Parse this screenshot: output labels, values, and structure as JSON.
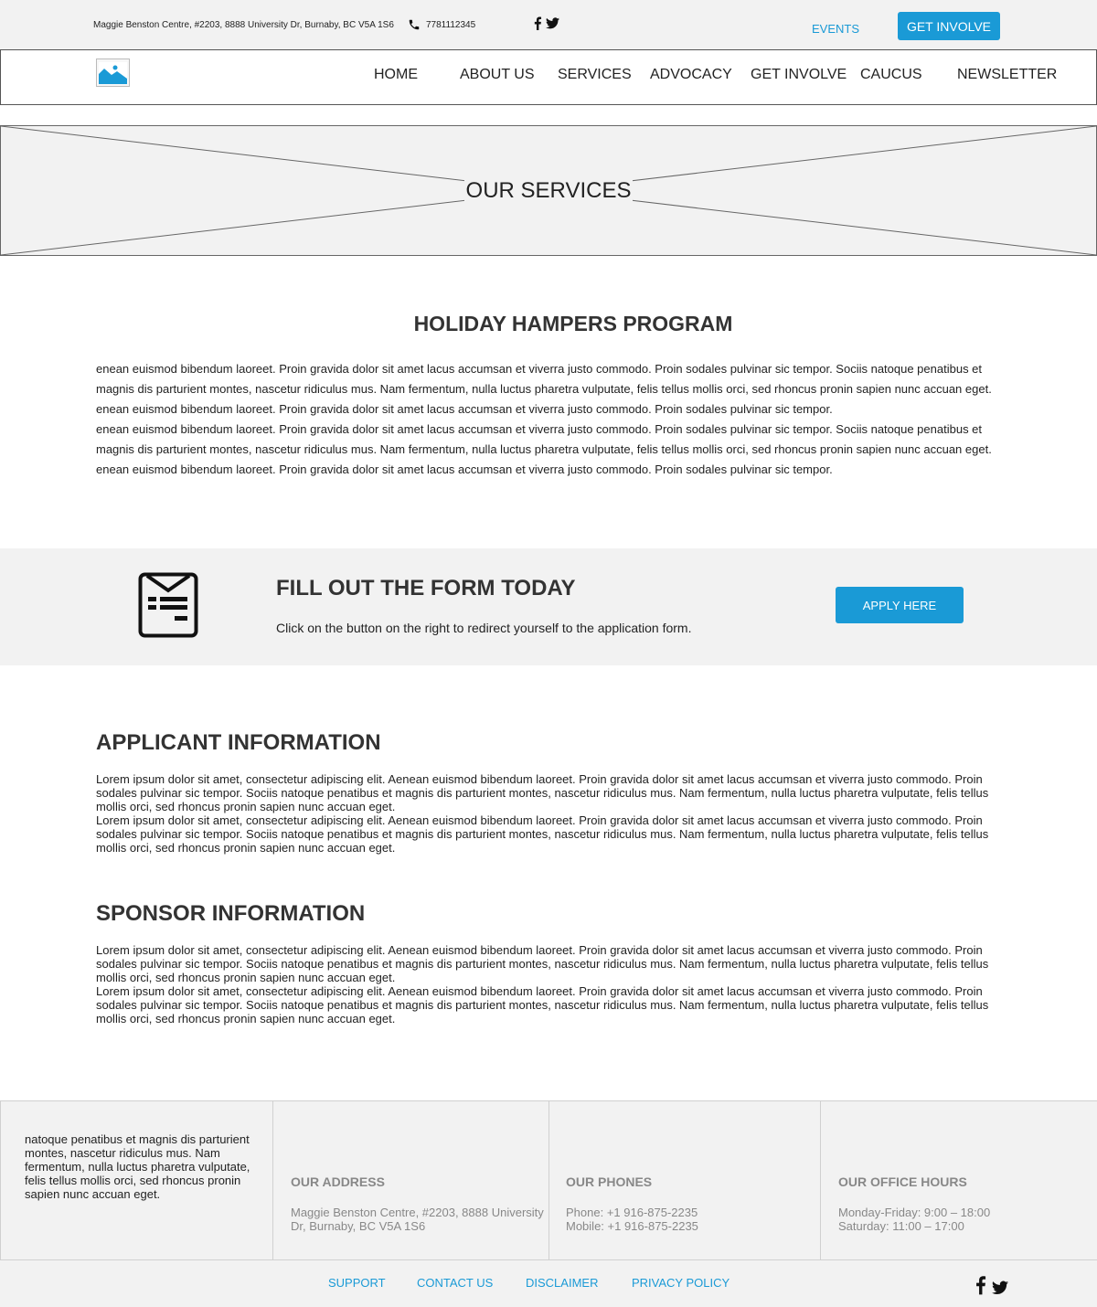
{
  "topbar": {
    "address": "Maggie Benston Centre, #2203, 8888 University Dr, Burnaby, BC V5A 1S6",
    "phone": "7781112345",
    "events_label": "EVENTS",
    "get_involve_label": "GET INVOLVE"
  },
  "nav": {
    "items": [
      {
        "label": "HOME"
      },
      {
        "label": "ABOUT US"
      },
      {
        "label": "SERVICES"
      },
      {
        "label": "ADVOCACY"
      },
      {
        "label": "GET INVOLVE"
      },
      {
        "label": "CAUCUS"
      },
      {
        "label": "NEWSLETTER"
      }
    ]
  },
  "hero": {
    "title": "OUR SERVICES"
  },
  "program": {
    "title": "HOLIDAY HAMPERS PROGRAM",
    "paragraphs": [
      "enean euismod bibendum laoreet. Proin gravida dolor sit amet lacus accumsan et viverra justo commodo. Proin sodales pulvinar sic tempor. Sociis natoque penatibus et magnis dis parturient montes, nascetur ridiculus mus. Nam fermentum, nulla luctus pharetra vulputate, felis tellus mollis orci, sed rhoncus pronin sapien nunc accuan eget.",
      "enean euismod bibendum laoreet. Proin gravida dolor sit amet lacus accumsan et viverra justo commodo. Proin sodales pulvinar sic tempor.",
      "enean euismod bibendum laoreet. Proin gravida dolor sit amet lacus accumsan et viverra justo commodo. Proin sodales pulvinar sic tempor. Sociis natoque penatibus et magnis dis parturient montes, nascetur ridiculus mus. Nam fermentum, nulla luctus pharetra vulputate, felis tellus mollis orci, sed rhoncus pronin sapien nunc accuan eget.",
      "enean euismod bibendum laoreet. Proin gravida dolor sit amet lacus accumsan et viverra justo commodo. Proin sodales pulvinar sic tempor."
    ]
  },
  "cta": {
    "title": "FILL OUT THE FORM TODAY",
    "subtitle": "Click on the button on the right to redirect yourself to the application form.",
    "button": "APPLY HERE"
  },
  "applicant": {
    "title": "APPLICANT INFORMATION",
    "paragraphs": [
      "Lorem ipsum dolor sit amet, consectetur adipiscing elit. Aenean euismod bibendum laoreet. Proin gravida dolor sit amet lacus accumsan et viverra justo commodo. Proin sodales pulvinar sic tempor. Sociis natoque penatibus et magnis dis parturient montes, nascetur ridiculus mus. Nam fermentum, nulla luctus pharetra vulputate, felis tellus mollis orci, sed rhoncus pronin sapien nunc accuan eget.",
      "Lorem ipsum dolor sit amet, consectetur adipiscing elit. Aenean euismod bibendum laoreet. Proin gravida dolor sit amet lacus accumsan et viverra justo commodo. Proin sodales pulvinar sic tempor. Sociis natoque penatibus et magnis dis parturient montes, nascetur ridiculus mus. Nam fermentum, nulla luctus pharetra vulputate, felis tellus mollis orci, sed rhoncus pronin sapien nunc accuan eget."
    ]
  },
  "sponsor": {
    "title": "SPONSOR INFORMATION",
    "paragraphs": [
      "Lorem ipsum dolor sit amet, consectetur adipiscing elit. Aenean euismod bibendum laoreet. Proin gravida dolor sit amet lacus accumsan et viverra justo commodo. Proin sodales pulvinar sic tempor. Sociis natoque penatibus et magnis dis parturient montes, nascetur ridiculus mus. Nam fermentum, nulla luctus pharetra vulputate, felis tellus mollis orci, sed rhoncus pronin sapien nunc accuan eget.",
      "Lorem ipsum dolor sit amet, consectetur adipiscing elit. Aenean euismod bibendum laoreet. Proin gravida dolor sit amet lacus accumsan et viverra justo commodo. Proin sodales pulvinar sic tempor. Sociis natoque penatibus et magnis dis parturient montes, nascetur ridiculus mus. Nam fermentum, nulla luctus pharetra vulputate, felis tellus mollis orci, sed rhoncus pronin sapien nunc accuan eget."
    ]
  },
  "footer": {
    "about": "natoque penatibus et magnis dis parturient montes, nascetur ridiculus mus. Nam fermentum, nulla luctus pharetra vulputate, felis tellus mollis orci, sed rhoncus pronin sapien nunc accuan eget.",
    "address_title": "OUR ADDRESS",
    "address_lines": [
      "Maggie Benston Centre, #2203, 8888 University",
      "Dr, Burnaby, BC V5A 1S6"
    ],
    "phones_title": "OUR PHONES",
    "phone_lines": [
      "Phone: +1 916-875-2235",
      "Mobile: +1 916-875-2235"
    ],
    "hours_title": "OUR OFFICE HOURS",
    "hours_lines": [
      "Monday-Friday: 9:00 – 18:00",
      "Saturday: 11:00 – 17:00"
    ]
  },
  "bottom_links": {
    "support": "SUPPORT",
    "contact": "CONTACT US",
    "disclaimer": "DISCLAIMER",
    "privacy": "PRIVACY POLICY"
  },
  "colors": {
    "accent": "#1a9ad6",
    "panel": "#f2f2f2",
    "heading": "#333333",
    "muted": "#888888"
  },
  "icons": [
    "phone-icon",
    "facebook-icon",
    "twitter-icon",
    "image-placeholder-icon",
    "form-icon"
  ]
}
